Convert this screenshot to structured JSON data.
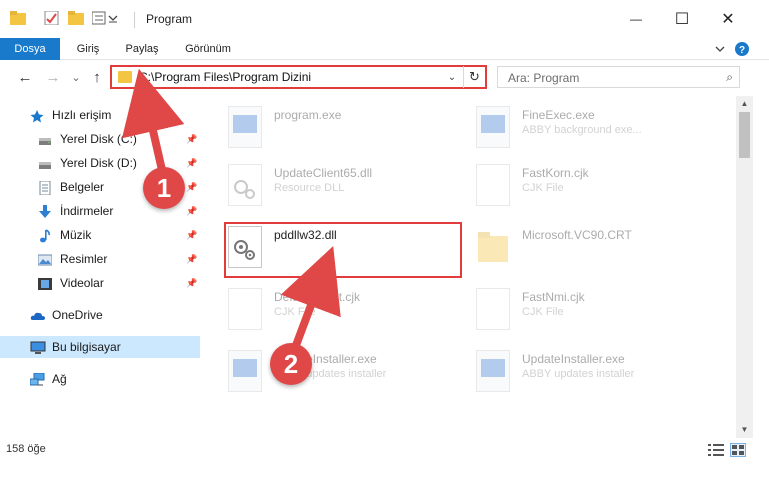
{
  "window": {
    "title": "Program",
    "minimize": "—",
    "maximize": "☐",
    "close": "✕"
  },
  "ribbon": {
    "tabs": [
      "Dosya",
      "Giriş",
      "Paylaş",
      "Görünüm"
    ],
    "collapse_icon": "chevron-down-icon",
    "help_icon": "help-icon"
  },
  "navigation": {
    "back": "←",
    "forward": "→",
    "recent": "⌄",
    "up": "↑",
    "address": "C:\\Program Files\\Program Dizini",
    "address_dropdown": "⌄",
    "refresh": "↻",
    "search_placeholder": "Ara: Program",
    "search_icon": "⌕"
  },
  "sidebar": {
    "items": [
      {
        "label": "Hızlı erişim",
        "icon": "star-icon",
        "pinned": false
      },
      {
        "label": "Yerel Disk (C:)",
        "icon": "drive-icon",
        "pinned": true
      },
      {
        "label": "Yerel Disk (D:)",
        "icon": "drive-icon",
        "pinned": true
      },
      {
        "label": "Belgeler",
        "icon": "documents-icon",
        "pinned": true
      },
      {
        "label": "İndirmeler",
        "icon": "download-icon",
        "pinned": true
      },
      {
        "label": "Müzik",
        "icon": "music-icon",
        "pinned": true
      },
      {
        "label": "Resimler",
        "icon": "pictures-icon",
        "pinned": true
      },
      {
        "label": "Videolar",
        "icon": "videos-icon",
        "pinned": true
      },
      {
        "label": "OneDrive",
        "icon": "cloud-icon",
        "pinned": false
      },
      {
        "label": "Bu bilgisayar",
        "icon": "computer-icon",
        "pinned": false,
        "selected": true
      },
      {
        "label": "Ağ",
        "icon": "network-icon",
        "pinned": false
      }
    ]
  },
  "files": [
    {
      "name": "program.exe",
      "type": "",
      "icon": "exe-icon",
      "highlighted": false
    },
    {
      "name": "FineExec.exe",
      "type": "ABBY background exe...",
      "icon": "exe-icon",
      "highlighted": false
    },
    {
      "name": "UpdateClient65.dll",
      "type": "Resource DLL",
      "icon": "dll-icon",
      "highlighted": false
    },
    {
      "name": "FastKorn.cjk",
      "type": "CJK File",
      "icon": "file-icon",
      "highlighted": false
    },
    {
      "name": "pddllw32.dll",
      "type": "",
      "icon": "dll-icon",
      "highlighted": true
    },
    {
      "name": "Microsoft.VC90.CRT",
      "type": "",
      "icon": "folder-icon",
      "highlighted": false
    },
    {
      "name": "DefaultIment.cjk",
      "type": "CJK File",
      "icon": "file-icon",
      "highlighted": false
    },
    {
      "name": "FastNmi.cjk",
      "type": "CJK File",
      "icon": "file-icon",
      "highlighted": false
    },
    {
      "name": "UpdateInstaller.exe",
      "type": "ABBY updates installer",
      "icon": "exe-icon",
      "highlighted": false
    },
    {
      "name": "UpdateInstaller.exe",
      "type": "ABBY updates installer",
      "icon": "exe-icon",
      "highlighted": false
    }
  ],
  "status": {
    "count": "158 öğe"
  },
  "annotations": {
    "step1": "1",
    "step2": "2"
  },
  "colors": {
    "accent": "#1979ca",
    "highlight": "#e23b3b",
    "badge": "#e04848",
    "selected": "#cce8ff"
  }
}
